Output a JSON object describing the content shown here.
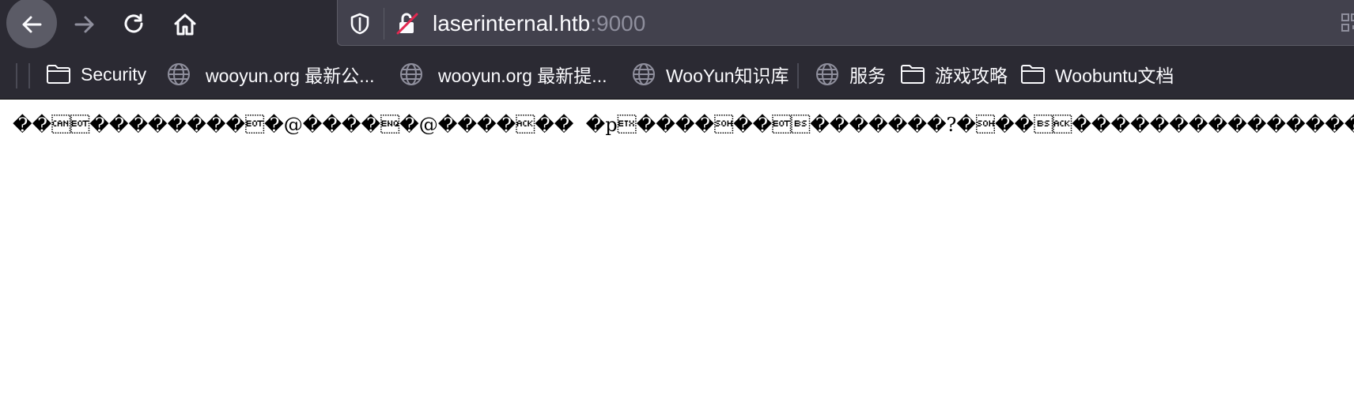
{
  "browser": {
    "url": {
      "host": "laserinternal.htb",
      "port": ":9000"
    },
    "buttons": {
      "back": "back-icon",
      "forward": "forward-icon",
      "reload": "reload-icon",
      "home": "home-icon"
    },
    "colors": {
      "toolbar_bg": "#2b2a33",
      "urlbar_bg": "#42414d",
      "back_highlight": "#5b5b66",
      "insecure_strike": "#e22850"
    }
  },
  "bookmarks": [
    {
      "label": "Security",
      "icon": "folder-icon"
    },
    {
      "label": "wooyun.org 最新公...",
      "icon": "globe-icon"
    },
    {
      "label": "wooyun.org 最新提...",
      "icon": "globe-icon"
    },
    {
      "label": "WooYun知识库",
      "icon": "globe-icon"
    },
    {
      "label": "服务",
      "icon": "globe-icon"
    },
    {
      "label": "游戏攻略",
      "icon": "folder-icon"
    },
    {
      "label": "Woobuntu文档",
      "icon": "folder-icon"
    }
  ],
  "page": {
    "body_text": "��\u0018\u0004��������\u0004�@����\u0005�@����\u0006��  �p\u0003����\u0001��\u0004\b�������?�\u0001��\b\u0006���������������"
  }
}
